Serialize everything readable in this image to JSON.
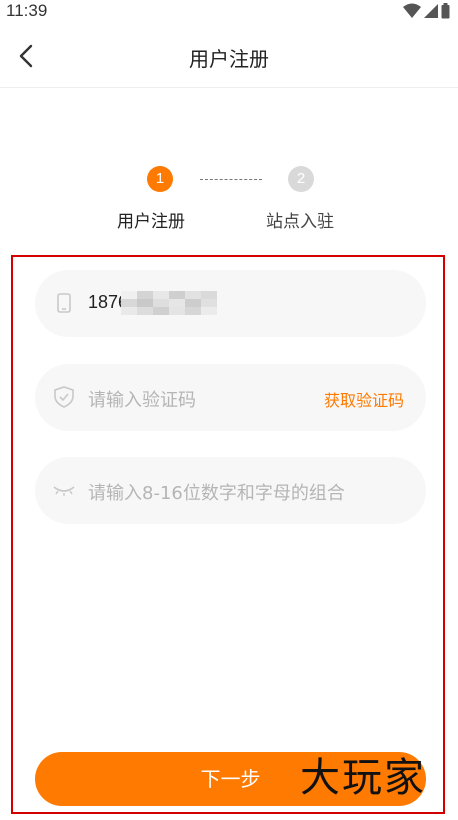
{
  "status_bar": {
    "time": "11:39",
    "icons": [
      "wifi-icon",
      "signal-icon",
      "battery-icon"
    ]
  },
  "header": {
    "title": "用户注册",
    "back_icon": "back-arrow-icon"
  },
  "steps": [
    {
      "number": "1",
      "label": "用户注册",
      "active": true
    },
    {
      "number": "2",
      "label": "站点入驻",
      "active": false
    }
  ],
  "form": {
    "phone": {
      "icon": "phone-icon",
      "value": "1876"
    },
    "code": {
      "icon": "shield-icon",
      "placeholder": "请输入验证码",
      "action_label": "获取验证码"
    },
    "password": {
      "icon": "eye-closed-icon",
      "placeholder": "请输入8-16位数字和字母的组合"
    }
  },
  "next_button": {
    "label": "下一步"
  },
  "watermark": {
    "text": "大玩家"
  },
  "colors": {
    "accent": "#ff7a00",
    "inactive_step": "#d9d9d9",
    "highlight_frame": "#d40000",
    "input_bg": "#f7f7f7"
  }
}
